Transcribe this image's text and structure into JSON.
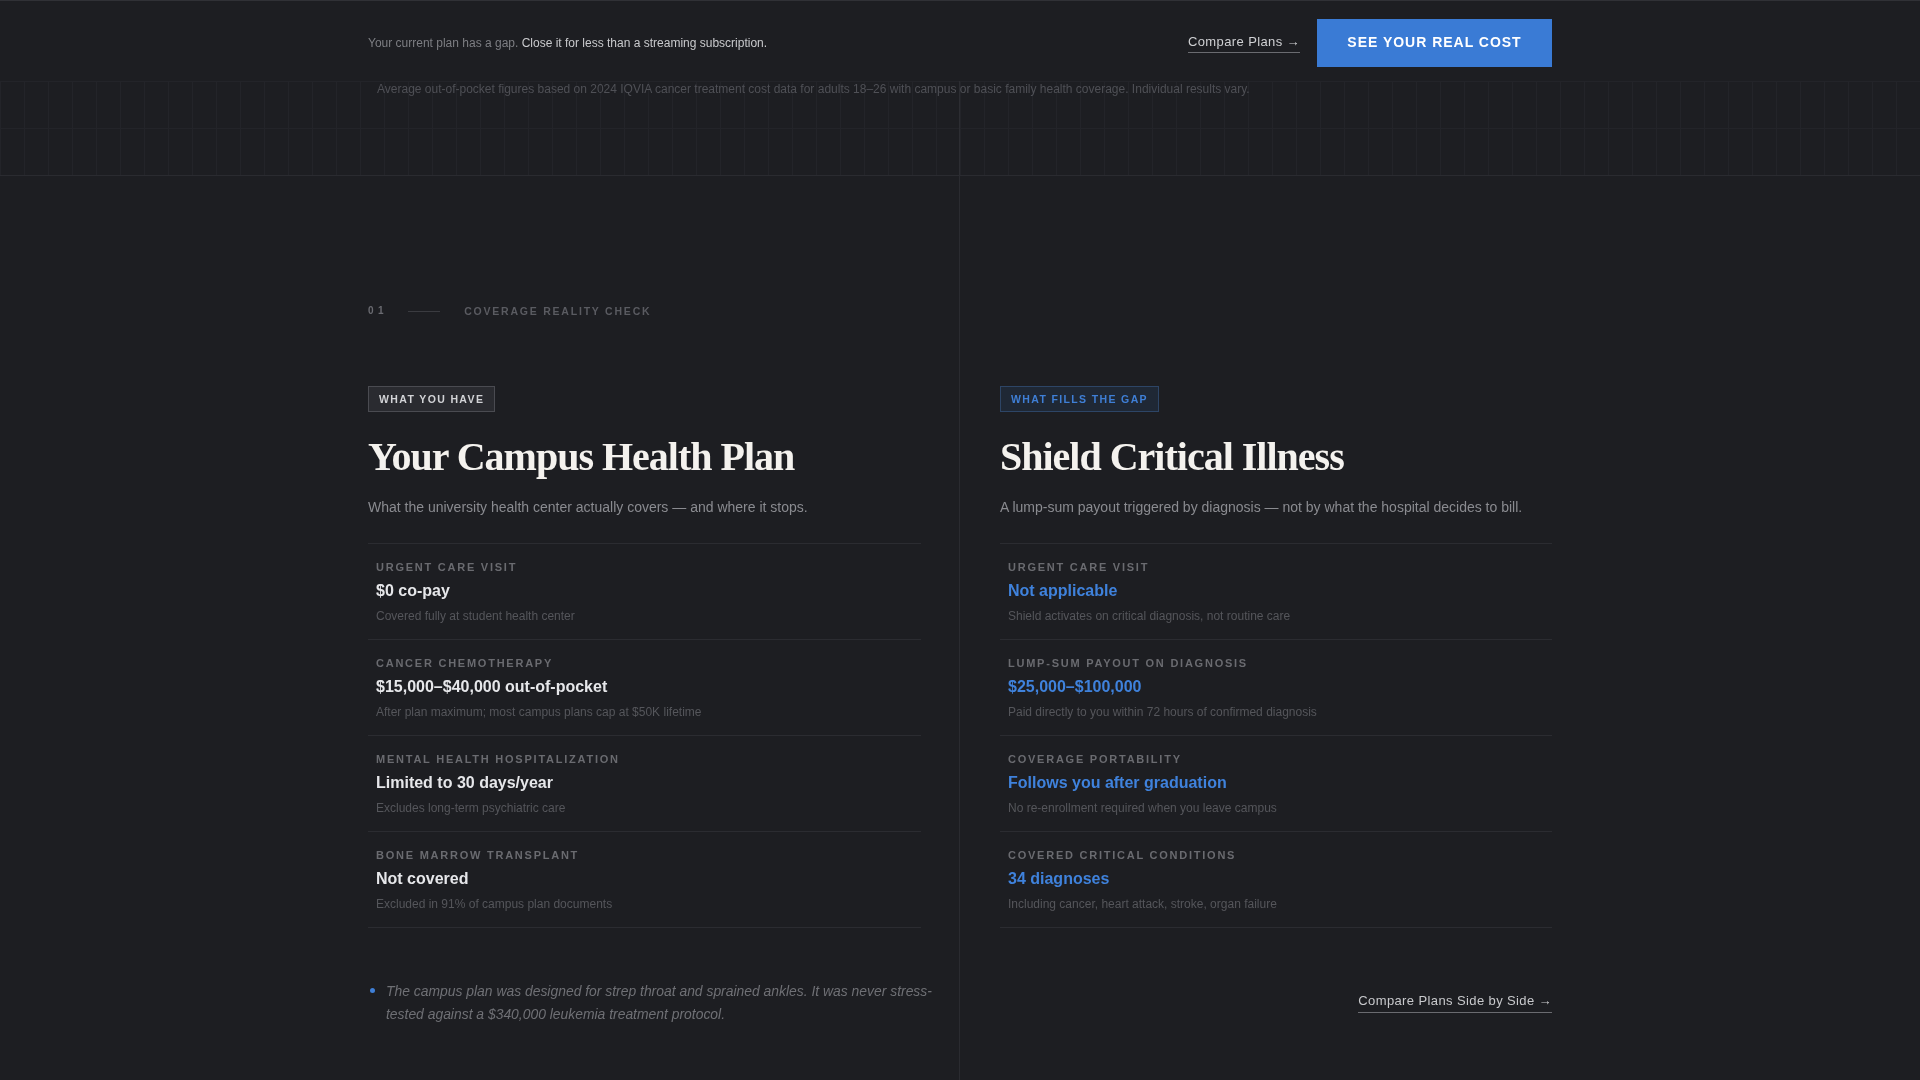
{
  "top_bar": {
    "message": {
      "lead": "Your current plan has a gap.",
      "emphasis": "Close it for less than a streaming subscription."
    },
    "link": "Compare Plans →",
    "button": "SEE YOUR REAL COST"
  },
  "disclaimer": "Average out-of-pocket figures based on 2024 IQVIA cancer treatment cost data for adults 18–26 with campus or basic family health coverage. Individual results vary.",
  "section": {
    "number": "01",
    "label": "COVERAGE REALITY CHECK"
  },
  "columns": [
    {
      "kind": "current",
      "badge": "WHAT YOU HAVE",
      "title": "Your Campus Health Plan",
      "subtitle": "What the university health center actually covers — and where it stops.",
      "rows": [
        {
          "label": "URGENT CARE VISIT",
          "value": "$0 co-pay",
          "note": "Covered fully at student health center"
        },
        {
          "label": "CANCER CHEMOTHERAPY",
          "value": "$15,000–$40,000 out-of-pocket",
          "note": "After plan maximum; most campus plans cap at $50K lifetime"
        },
        {
          "label": "MENTAL HEALTH HOSPITALIZATION",
          "value": "Limited to 30 days/year",
          "note": "Excludes long-term psychiatric care"
        },
        {
          "label": "BONE MARROW TRANSPLANT",
          "value": "Not covered",
          "note": "Excluded in 91% of campus plan documents"
        }
      ],
      "footnote": "The campus plan was designed for strep throat and sprained ankles. It was never stress-tested against a $340,000 leukemia treatment protocol."
    },
    {
      "kind": "alternative",
      "badge": "WHAT FILLS THE GAP",
      "title": "Shield Critical Illness",
      "subtitle": "A lump-sum payout triggered by diagnosis — not by what the hospital decides to bill.",
      "rows": [
        {
          "label": "URGENT CARE VISIT",
          "value": "Not applicable",
          "note": "Shield activates on critical diagnosis, not routine care"
        },
        {
          "label": "LUMP-SUM PAYOUT ON DIAGNOSIS",
          "value": "$25,000–$100,000",
          "note": "Paid directly to you within 72 hours of confirmed diagnosis"
        },
        {
          "label": "COVERAGE PORTABILITY",
          "value": "Follows you after graduation",
          "note": "No re-enrollment required when you leave campus"
        },
        {
          "label": "COVERED CRITICAL CONDITIONS",
          "value": "34 diagnoses",
          "note": "Including cancer, heart attack, stroke, organ failure"
        }
      ],
      "link": "Compare Plans Side by Side →"
    }
  ]
}
